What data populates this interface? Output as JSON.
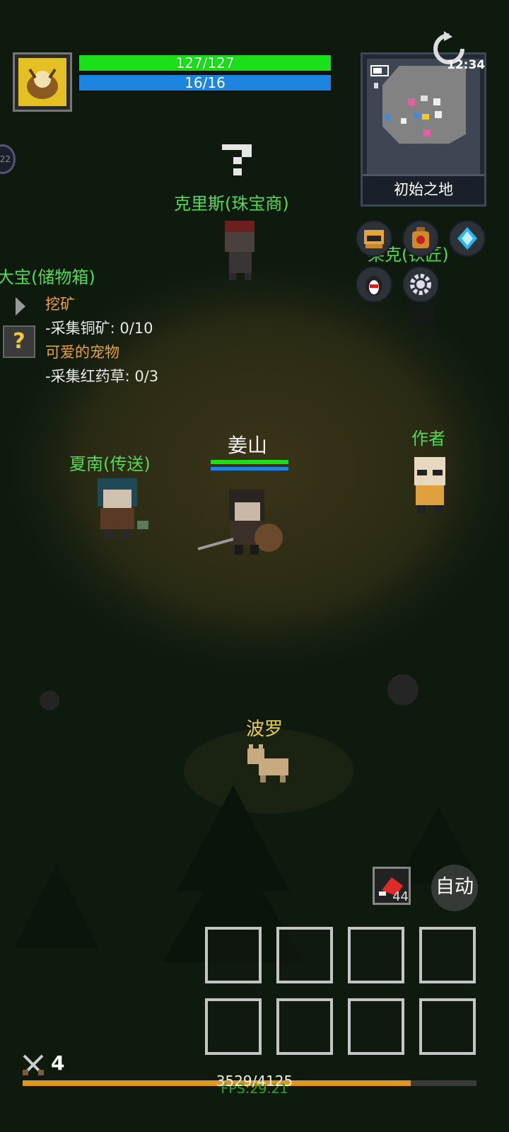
{
  "hud": {
    "hp_text": "127/127",
    "hp_fraction": 1.0,
    "mp_text": "16/16",
    "mp_fraction": 1.0,
    "clock": "12:34",
    "minimap_caption": "初始之地"
  },
  "npcs": {
    "jeweler": "克里斯(珠宝商)",
    "storage": "大宝(储物箱)",
    "blacksmith": "莱克(铁匠)",
    "teleport": "夏南(传送)",
    "author": "作者",
    "pet": "波罗",
    "player": "姜山"
  },
  "quests": [
    {
      "title": "挖矿",
      "progress": "-采集铜矿: 0/10"
    },
    {
      "title": "可爱的宠物",
      "progress": "-采集红药草: 0/3"
    }
  ],
  "quest_marker": "?",
  "side_badge": "22",
  "quick_item_count": "44",
  "auto_label": "自动",
  "level": "4",
  "exp": {
    "text": "3529/4125",
    "fraction": 0.855
  },
  "fps": "FPS:29.21",
  "colors": {
    "hp": "#19e019",
    "mp": "#1d84e0",
    "npc_name": "#57d957",
    "pet_name": "#e8cd55",
    "exp": "#e09620"
  }
}
